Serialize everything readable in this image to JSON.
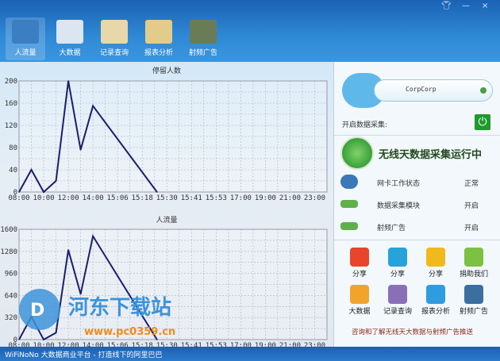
{
  "window": {
    "skin_icon": "shirt-icon",
    "minimize": "—",
    "close": "×"
  },
  "toolbar": [
    {
      "label": "人流量",
      "icon": "line-chart-icon",
      "active": true,
      "color": "#3b7fc2"
    },
    {
      "label": "大数据",
      "icon": "table-icon",
      "color": "#dce6f3"
    },
    {
      "label": "记录查询",
      "icon": "search-record-icon",
      "color": "#e8d7a8"
    },
    {
      "label": "报表分析",
      "icon": "report-icon",
      "color": "#e3cc8a"
    },
    {
      "label": "射频广告",
      "icon": "android-icon",
      "color": "#6a7c56"
    }
  ],
  "chart_data": [
    {
      "type": "line",
      "title": "停留人数",
      "x_labels": [
        "08:00",
        "10:00",
        "12:00",
        "14:00",
        "15:06",
        "15:18",
        "15:30",
        "15:41",
        "15:53",
        "17:00",
        "19:00",
        "21:00",
        "23:00"
      ],
      "x_index": [
        0,
        1,
        2,
        3,
        4,
        5,
        6,
        11.2
      ],
      "values": [
        0,
        40,
        0,
        20,
        200,
        76,
        155,
        0
      ],
      "ylim": [
        0,
        200
      ],
      "yticks": [
        0,
        40,
        80,
        120,
        160,
        200
      ],
      "grid": true,
      "color": "#1a1f6e"
    },
    {
      "type": "line",
      "title": "人流量",
      "x_labels": [
        "08:00",
        "10:00",
        "12:00",
        "14:00",
        "15:06",
        "15:18",
        "15:30",
        "15:41",
        "15:53",
        "17:00",
        "19:00",
        "21:00",
        "23:00"
      ],
      "x_index": [
        0,
        1,
        2,
        3,
        4,
        5,
        6,
        11.2
      ],
      "values": [
        0,
        330,
        0,
        100,
        1300,
        660,
        1500,
        0
      ],
      "ylim": [
        0,
        1600
      ],
      "yticks": [
        0,
        320,
        640,
        960,
        1280,
        1600
      ],
      "grid": true,
      "color": "#1a1f6e"
    }
  ],
  "right": {
    "device_name": "CorpCorp",
    "start_label": "开启数据采集:",
    "running_text": "无线天数据采集运行中",
    "status_rows": [
      {
        "label": "网卡工作状态",
        "value": "正常"
      },
      {
        "label": "数据采集模块",
        "value": "开启"
      },
      {
        "label": "射频广告",
        "value": "开启"
      }
    ],
    "shortcuts": [
      {
        "label": "分享",
        "icon": "weibo-icon",
        "color": "#e8452c"
      },
      {
        "label": "分享",
        "icon": "tencent-weibo-icon",
        "color": "#27a3d8"
      },
      {
        "label": "分享",
        "icon": "qzone-icon",
        "color": "#f0b91c"
      },
      {
        "label": "捐助我们",
        "icon": "donate-icon",
        "color": "#7cc142"
      },
      {
        "label": "大数据",
        "icon": "bigdata-icon",
        "color": "#f2a32b"
      },
      {
        "label": "记录查询",
        "icon": "record-icon",
        "color": "#8a6fb8"
      },
      {
        "label": "报表分析",
        "icon": "cloud-icon",
        "color": "#2f9be0"
      },
      {
        "label": "射频广告",
        "icon": "shield-icon",
        "color": "#3a6fa0"
      }
    ],
    "consult_link": "咨询和了解无线天大数据与射频广告推送"
  },
  "status_bar": "WiFiNoNo 大数据商业平台 - 打造线下的阿里巴巴",
  "watermark": {
    "name": "河东下载站",
    "url": "www.pc0359.cn"
  }
}
